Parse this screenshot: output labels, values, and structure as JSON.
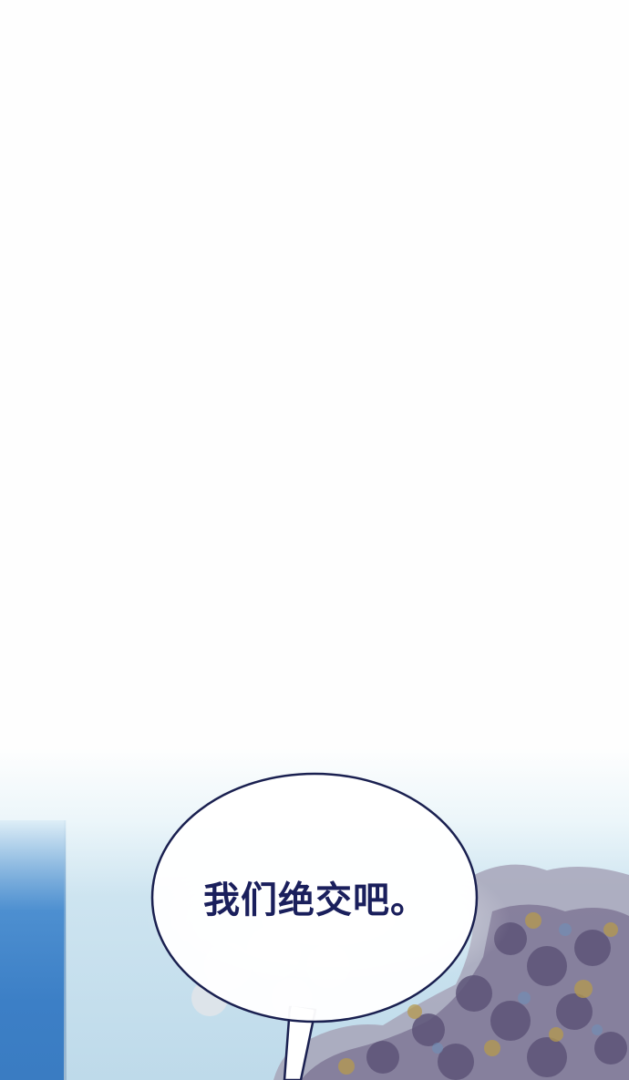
{
  "panel": {
    "speech_bubble": {
      "text": "我们绝交吧。"
    }
  }
}
